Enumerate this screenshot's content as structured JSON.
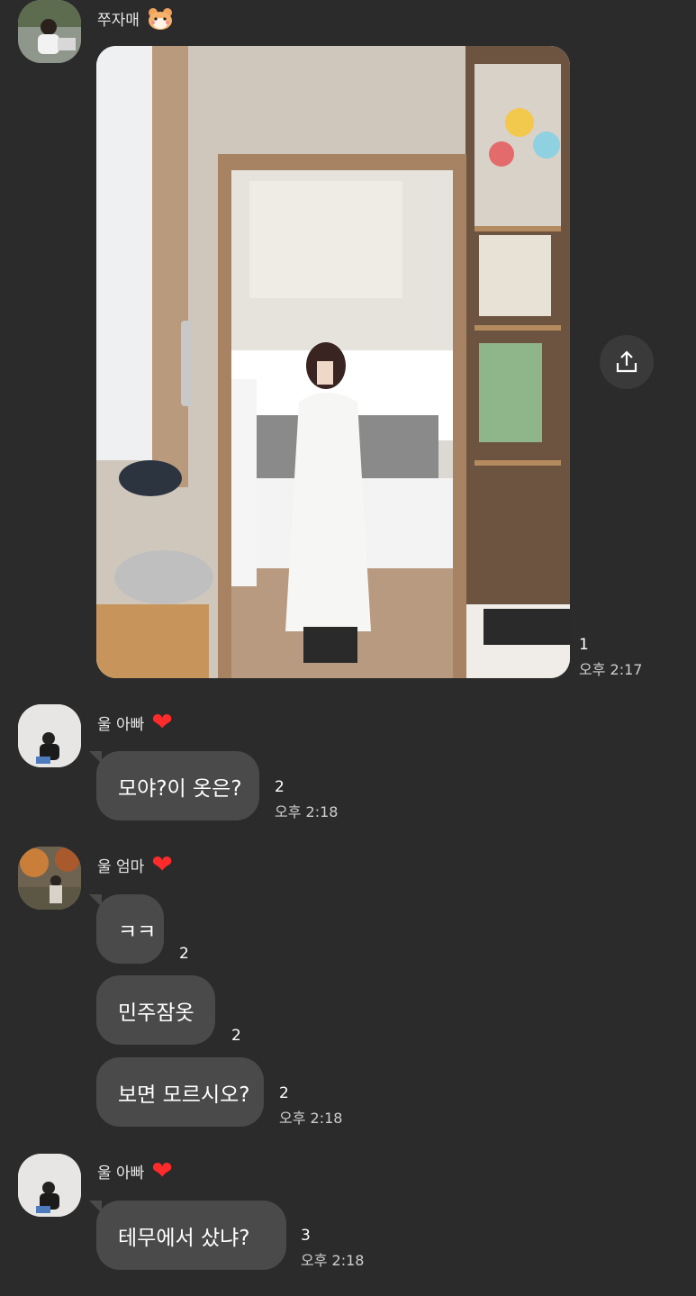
{
  "messages": [
    {
      "sender": "쭈자매",
      "sender_icon": "hamster-icon",
      "photo": {
        "description_icon": "mirror-selfie-photo"
      },
      "read_count": "1",
      "time": "오후 2:17"
    },
    {
      "sender": "울 아빠",
      "sender_icon": "heart-icon",
      "text": "모야?이 옷은?",
      "read_count": "2",
      "time": "오후 2:18"
    },
    {
      "sender": "울 엄마",
      "sender_icon": "heart-icon",
      "bubbles": [
        {
          "text": "ㅋㅋ",
          "read_count": "2"
        },
        {
          "text": "민주잠옷",
          "read_count": "2"
        },
        {
          "text": "보면 모르시오?",
          "read_count": "2",
          "time": "오후 2:18"
        }
      ]
    },
    {
      "sender": "울 아빠",
      "sender_icon": "heart-icon",
      "text": "테무에서 샀냐?",
      "read_count": "3",
      "time": "오후 2:18"
    }
  ],
  "colors": {
    "background": "#2b2b2b",
    "bubble": "#4a4a4a",
    "heart": "#ff2a2a"
  }
}
